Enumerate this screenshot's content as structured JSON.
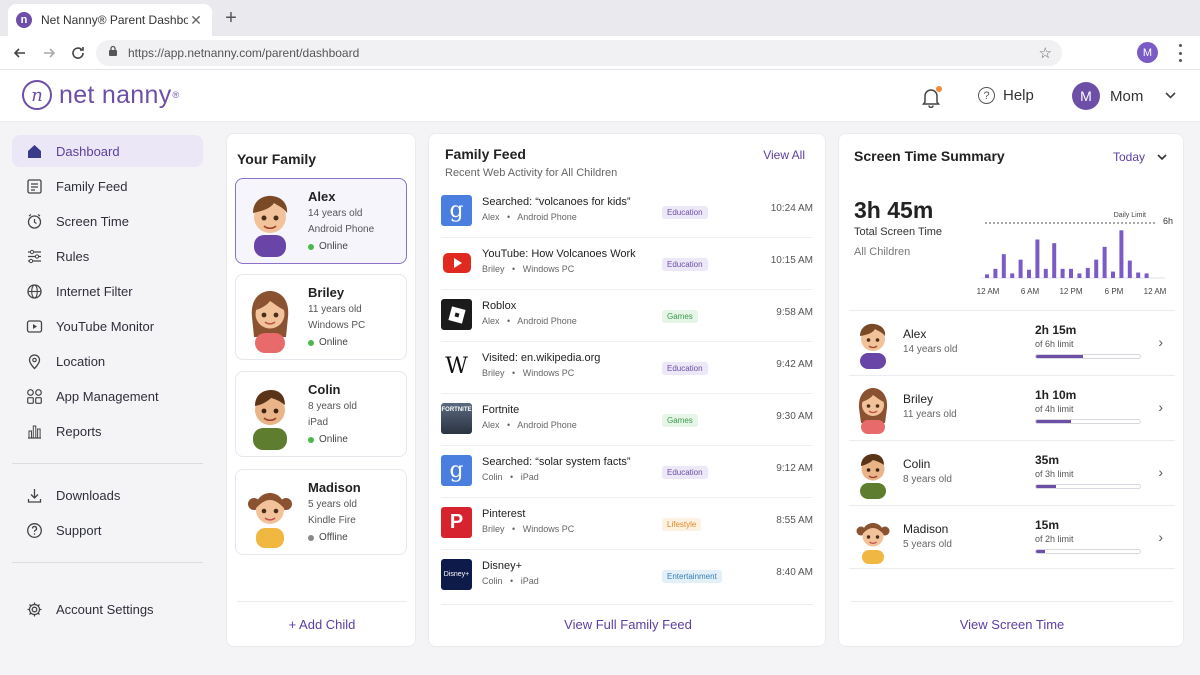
{
  "browser": {
    "tab_title": "Net Nanny® Parent Dashboard",
    "tab_favicon": "n",
    "close": "✕",
    "new_tab": "+",
    "url": "https://app.netnanny.com/parent/dashboard",
    "profile_initial": "M"
  },
  "header": {
    "logo_text": "net nanny",
    "logo_mark": "n",
    "logo_reg": "®",
    "help_label": "Help",
    "user_initial": "M",
    "user_name": "Mom",
    "accent_color": "#6e4fa8"
  },
  "sidebar": {
    "items": [
      {
        "label": "Dashboard",
        "icon": "home-icon",
        "active": true
      },
      {
        "label": "Family Feed",
        "icon": "feed-icon"
      },
      {
        "label": "Screen Time",
        "icon": "clock-icon"
      },
      {
        "label": "Rules",
        "icon": "sliders-icon"
      },
      {
        "label": "Internet Filter",
        "icon": "globe-icon"
      },
      {
        "label": "YouTube Monitor",
        "icon": "play-icon"
      },
      {
        "label": "Location",
        "icon": "pin-icon"
      },
      {
        "label": "App Management",
        "icon": "grid-icon"
      },
      {
        "label": "Reports",
        "icon": "chart-icon"
      }
    ],
    "secondary": [
      {
        "label": "Downloads",
        "icon": "download-icon"
      },
      {
        "label": "Support",
        "icon": "question-icon"
      }
    ],
    "settings_label": "Account Settings"
  },
  "family": {
    "title": "Your Family",
    "children": [
      {
        "name": "Alex",
        "age": "14 years old",
        "device": "Android Phone",
        "status": "Online",
        "online": true
      },
      {
        "name": "Briley",
        "age": "11 years old",
        "device": "Windows PC",
        "status": "Online",
        "online": true
      },
      {
        "name": "Colin",
        "age": "8 years old",
        "device": "iPad",
        "status": "Online",
        "online": true
      },
      {
        "name": "Madison",
        "age": "5 years old",
        "device": "Kindle Fire",
        "status": "Offline",
        "online": false
      }
    ],
    "add_child": "+ Add Child"
  },
  "feed": {
    "title": "Family Feed",
    "subtitle": "Recent Web Activity for All Children",
    "view_all": "View All",
    "items": [
      {
        "title": "Searched:  “volcanoes for kids”",
        "child": "Alex",
        "device": "Android Phone",
        "tag": "Education",
        "time": "10:24 AM",
        "icon": "google-search-icon"
      },
      {
        "title": "YouTube:  How Volcanoes Work",
        "child": "Briley",
        "device": "Windows PC",
        "tag": "Education",
        "time": "10:15 AM",
        "icon": "youtube-icon"
      },
      {
        "title": "Roblox",
        "child": "Alex",
        "device": "Android Phone",
        "tag": "Games",
        "time": "9:58 AM",
        "icon": "roblox-icon"
      },
      {
        "title": "Visited:  en.wikipedia.org",
        "child": "Briley",
        "device": "Windows PC",
        "tag": "Education",
        "time": "9:42 AM",
        "icon": "wikipedia-icon"
      },
      {
        "title": "Fortnite",
        "child": "Alex",
        "device": "Android Phone",
        "tag": "Games",
        "time": "9:30 AM",
        "icon": "fortnite-icon"
      },
      {
        "title": "Searched:  “solar system facts”",
        "child": "Colin",
        "device": "iPad",
        "tag": "Education",
        "time": "9:12 AM",
        "icon": "google-search-icon"
      },
      {
        "title": "Pinterest",
        "child": "Briley",
        "device": "Windows PC",
        "tag": "Lifestyle",
        "time": "8:55 AM",
        "icon": "pinterest-icon"
      },
      {
        "title": "Disney+",
        "child": "Colin",
        "device": "iPad",
        "tag": "Entertainment",
        "time": "8:40 AM",
        "icon": "disney-plus-icon"
      }
    ],
    "icon_text": {
      "google": "g",
      "wikipedia": "W",
      "fortnite": "FORTNITE",
      "pinterest": "P",
      "disney": "Disney+"
    },
    "separator": "•",
    "footer": "View Full Family Feed"
  },
  "screen_time": {
    "title": "Screen Time Summary",
    "period": "Today",
    "total": "3h 45m",
    "total_label": "Total Screen Time",
    "total_sub": "All Children",
    "daily_limit_label": "Daily Limit",
    "daily_limit_value": "6h",
    "chart_data": {
      "type": "bar",
      "x_ticks": [
        "12 AM",
        "6 AM",
        "12 PM",
        "6 PM",
        "12 AM"
      ],
      "values": [
        0.4,
        1.0,
        2.6,
        0.5,
        2.0,
        0.9,
        4.2,
        1.0,
        3.8,
        1.0,
        1.0,
        0.5,
        1.1,
        2.0,
        3.4,
        0.7,
        5.2,
        1.9,
        0.6,
        0.5
      ],
      "unit_hint": "relative height (daily limit line = 6)",
      "limit": 6,
      "color": "#7b5cc7"
    },
    "children": [
      {
        "name": "Alex",
        "age": "14 years old",
        "time": "2h 15m",
        "limit": "of 6h limit",
        "fraction": 0.45
      },
      {
        "name": "Briley",
        "age": "11 years old",
        "time": "1h 10m",
        "limit": "of 4h limit",
        "fraction": 0.34
      },
      {
        "name": "Colin",
        "age": "8 years old",
        "time": "35m",
        "limit": "of 3h limit",
        "fraction": 0.19
      },
      {
        "name": "Madison",
        "age": "5 years old",
        "time": "15m",
        "limit": "of 2h limit",
        "fraction": 0.09
      }
    ],
    "chevron": "›",
    "footer": "View Screen Time"
  }
}
